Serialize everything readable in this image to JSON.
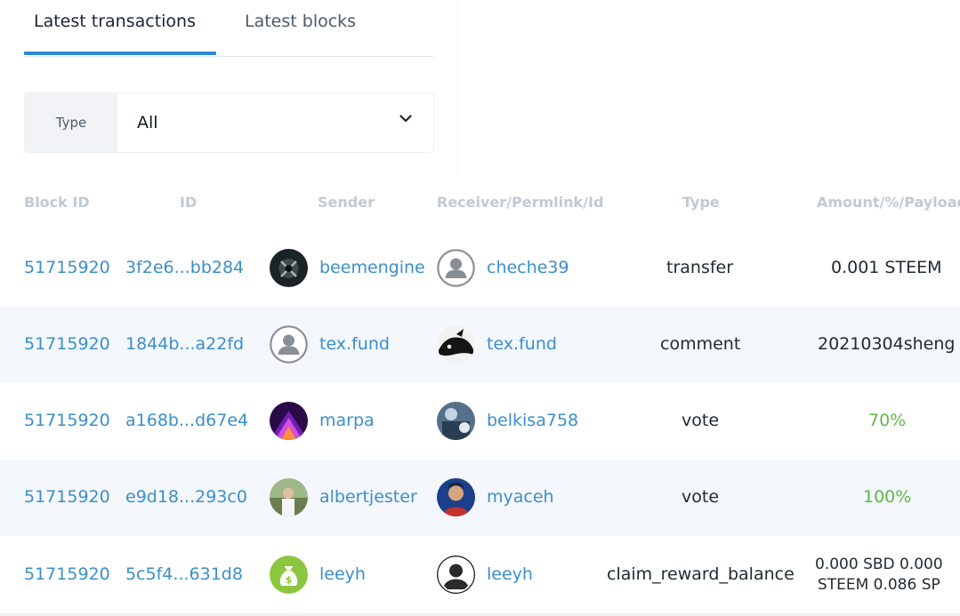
{
  "tabs": [
    {
      "label": "Latest transactions",
      "active": true
    },
    {
      "label": "Latest blocks",
      "active": false
    }
  ],
  "filter": {
    "label": "Type",
    "value": "All"
  },
  "table": {
    "headers": [
      "Block ID",
      "ID",
      "Sender",
      "Receiver/Permlink/Id",
      "Type",
      "Amount/%/Payload"
    ],
    "rows": [
      {
        "block_id": "51715920",
        "id": "3f2e6...bb284",
        "sender": "beemengine",
        "sender_avatar": "dark-skull-avatar",
        "receiver": "cheche39",
        "receiver_avatar": "default-user-avatar",
        "type": "transfer",
        "amount": "0.001 STEEM"
      },
      {
        "block_id": "51715920",
        "id": "1844b...a22fd",
        "sender": "tex.fund",
        "sender_avatar": "default-user-avatar",
        "receiver": "tex.fund",
        "receiver_avatar": "bw-bull-avatar",
        "type": "comment",
        "amount": "20210304sheng"
      },
      {
        "block_id": "51715920",
        "id": "a168b...d67e4",
        "sender": "marpa",
        "sender_avatar": "purple-neon-avatar",
        "receiver": "belkisa758",
        "receiver_avatar": "blue-photo-avatar",
        "type": "vote",
        "amount": "70%"
      },
      {
        "block_id": "51715920",
        "id": "e9d18...293c0",
        "sender": "albertjester",
        "sender_avatar": "outdoor-photo-avatar",
        "receiver": "myaceh",
        "receiver_avatar": "portrait-avatar",
        "type": "vote",
        "amount": "100%"
      },
      {
        "block_id": "51715920",
        "id": "5c5f4...631d8",
        "sender": "leeyh",
        "sender_avatar": "green-money-bag-avatar",
        "receiver": "leeyh",
        "receiver_avatar": "bw-sketch-avatar",
        "type": "claim_reward_balance",
        "amount_lines": [
          "0.000 SBD 0.000",
          "STEEM 0.086 SP"
        ]
      }
    ]
  }
}
